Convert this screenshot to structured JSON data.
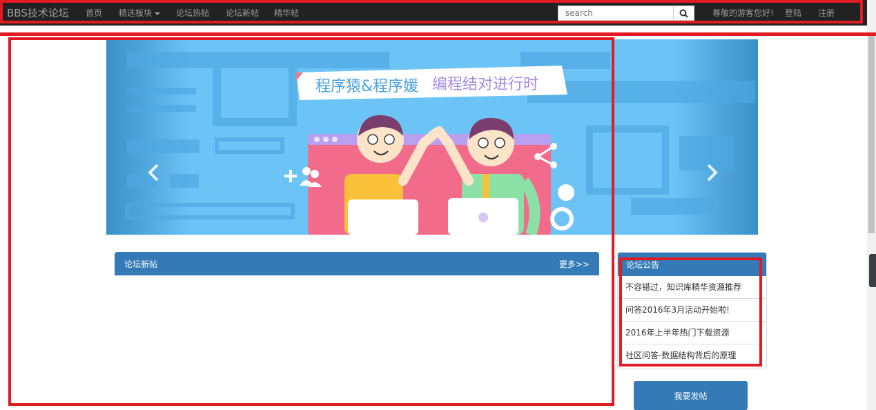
{
  "navbar": {
    "brand": "BBS技术论坛",
    "links": [
      "首页",
      "精选板块",
      "论坛热帖",
      "论坛新帖",
      "精华帖"
    ],
    "search": {
      "placeholder": "search"
    },
    "greeting": "尊敬的游客您好!",
    "login": "登陆",
    "register": "注册"
  },
  "banner": {
    "headline_part1": "程序猿&程序媛",
    "headline_part2": "编程结对进行时",
    "slide_count": 3,
    "active_slide": 2
  },
  "new_posts": {
    "title": "论坛新帖",
    "more": "更多>>"
  },
  "announcements": {
    "title": "论坛公告",
    "items": [
      "不容错过，知识库精华资源推荐",
      "问答2016年3月活动开始啦!",
      "2016年上半年热门下载资源",
      "社区问答-数据结构背后的原理"
    ]
  },
  "post_button": "我要发帖",
  "colors": {
    "navbar_bg": "#222222",
    "primary": "#337ab7",
    "annotation": "#e21b23",
    "banner_bg": "#6cc3f5"
  },
  "icons": [
    "search-icon",
    "chevron-left-icon",
    "chevron-right-icon",
    "caret-down-icon"
  ]
}
